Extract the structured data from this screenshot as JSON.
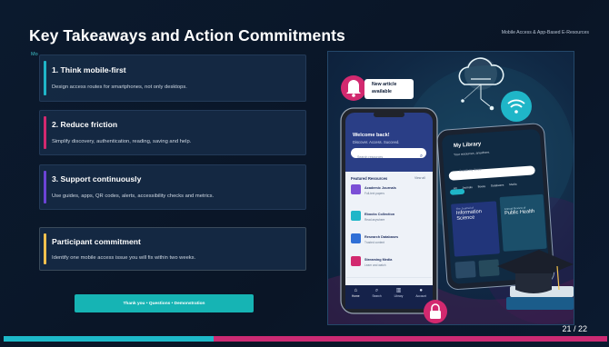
{
  "slide": {
    "title": "Key Takeaways and Action Commitments",
    "tag": "Mobile Access & App-Based E-Resources",
    "sub_cut": "Mo",
    "cards": [
      {
        "heading": "1. Think mobile-first",
        "text": "Design access routes for smartphones, not only desktops.",
        "accent": "#1fb6c8"
      },
      {
        "heading": "2. Reduce friction",
        "text": "Simplify discovery, authentication, reading, saving and help.",
        "accent": "#d2296f"
      },
      {
        "heading": "3. Support continuously",
        "text": "Use guides, apps, QR codes, alerts, accessibility checks and metrics.",
        "accent": "#6b43d6"
      },
      {
        "heading": "Participant commitment",
        "text": "Identify one mobile access issue you will fix within two weeks.",
        "accent": "#f2c14e"
      }
    ],
    "cta": "Thank you • Questions • Demonstration",
    "page_number": "21 / 22"
  },
  "illustration": {
    "notification": {
      "line1": "New article",
      "line2": "available"
    },
    "phone_front": {
      "welcome": "Welcome back!",
      "tagline": "Discover. Access. Succeed.",
      "search_placeholder": "Search resources",
      "section": "Featured Resources",
      "view_all": "View all",
      "items": [
        {
          "title": "Academic Journals",
          "sub": "Full-text papers",
          "color": "#7b4fd6"
        },
        {
          "title": "Ebooks Collection",
          "sub": "Read anywhere",
          "color": "#1fb6c8"
        },
        {
          "title": "Research Databases",
          "sub": "Trusted content",
          "color": "#2f6fd6"
        },
        {
          "title": "Streaming Media",
          "sub": "Learn and watch",
          "color": "#d2296f"
        }
      ],
      "nav": [
        "Home",
        "Search",
        "Library",
        "Account"
      ]
    },
    "phone_back": {
      "title": "My Library",
      "subtitle": "Your resources, anywhere.",
      "search_placeholder": "Search my library",
      "tabs": [
        "All",
        "Journals",
        "Books",
        "Databases",
        "Media"
      ],
      "book1": {
        "small": "The Journal of",
        "line1": "Information",
        "line2": "Science"
      },
      "book2": {
        "small": "Annual Review of",
        "line1": "Public Health"
      }
    },
    "colors": {
      "teal": "#1fb6c8",
      "pink": "#d2296f",
      "purple": "#6b43d6",
      "yellow": "#f2c14e"
    }
  }
}
